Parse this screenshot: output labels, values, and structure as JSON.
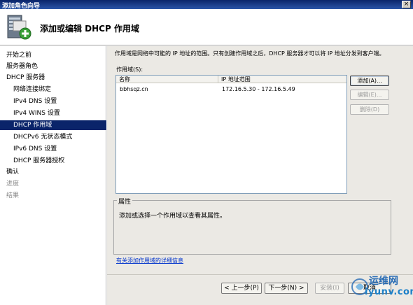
{
  "window": {
    "title": "添加角色向导",
    "close_glyph": "×"
  },
  "header": {
    "title": "添加或编辑 DHCP 作用域",
    "icon": "server-with-plus-icon"
  },
  "nav": {
    "items": [
      {
        "label": "开始之前",
        "level": 0,
        "state": "normal"
      },
      {
        "label": "服务器角色",
        "level": 0,
        "state": "normal"
      },
      {
        "label": "DHCP 服务器",
        "level": 0,
        "state": "normal"
      },
      {
        "label": "网络连接绑定",
        "level": 1,
        "state": "normal"
      },
      {
        "label": "IPv4 DNS 设置",
        "level": 1,
        "state": "normal"
      },
      {
        "label": "IPv4 WINS 设置",
        "level": 1,
        "state": "normal"
      },
      {
        "label": "DHCP 作用域",
        "level": 1,
        "state": "active"
      },
      {
        "label": "DHCPv6 无状态模式",
        "level": 1,
        "state": "normal"
      },
      {
        "label": "IPv6 DNS 设置",
        "level": 1,
        "state": "normal"
      },
      {
        "label": "DHCP 服务器授权",
        "level": 1,
        "state": "normal"
      },
      {
        "label": "确认",
        "level": 0,
        "state": "normal"
      },
      {
        "label": "进度",
        "level": 0,
        "state": "dim"
      },
      {
        "label": "结果",
        "level": 0,
        "state": "dim"
      }
    ]
  },
  "main": {
    "description": "作用域是网络中可能的 IP 地址的范围。只有创建作用域之后，DHCP 服务器才可以将 IP 地址分发到客户端。",
    "scopes_label": "作用域(S):",
    "table": {
      "columns": [
        "名称",
        "IP 地址范围"
      ],
      "rows": [
        {
          "name": "bbhsqz.cn",
          "range": "172.16.5.30 - 172.16.5.49"
        }
      ]
    },
    "buttons": {
      "add": "添加(A)...",
      "edit": "编辑(E)...",
      "delete": "删除(D)"
    },
    "properties": {
      "title": "属性",
      "text": "添加或选择一个作用域以查看其属性。"
    },
    "more_info_link": "有关添加作用域的详细信息"
  },
  "footer": {
    "prev": "< 上一步(P)",
    "next": "下一步(N) >",
    "install": "安装(I)",
    "cancel": "取消"
  },
  "watermark": {
    "cn": "运维网",
    "en": "iyunv.com"
  }
}
